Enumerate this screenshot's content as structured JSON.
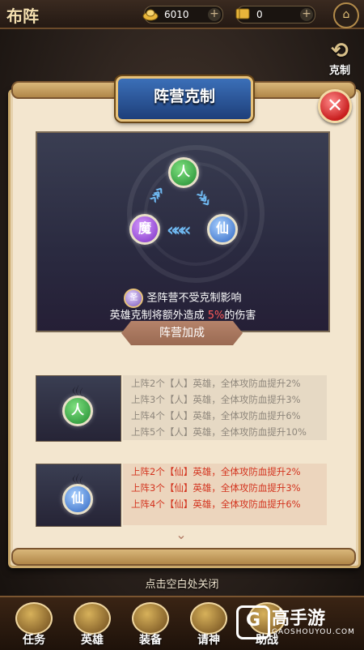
{
  "header": {
    "title": "布阵",
    "gold_value": "6010",
    "ticket_value": "0",
    "side_button_label": "克制"
  },
  "dialog": {
    "title": "阵营克制",
    "nodes": {
      "ren": "人",
      "mo": "魔",
      "xian": "仙"
    },
    "saint_text": "圣阵营不受克制影响",
    "bonus_prefix": "英雄克制将额外造成",
    "bonus_value": "5%",
    "bonus_suffix": "的伤害",
    "section_title": "阵营加成",
    "ren_bonuses": [
      "上阵2个【人】英雄，全体攻防血提升2%",
      "上阵3个【人】英雄，全体攻防血提升3%",
      "上阵4个【人】英雄，全体攻防血提升6%",
      "上阵5个【人】英雄，全体攻防血提升10%"
    ],
    "xian_bonuses": [
      "上阵2个【仙】英雄，全体攻防血提升2%",
      "上阵3个【仙】英雄，全体攻防血提升3%",
      "上阵4个【仙】英雄，全体攻防血提升6%"
    ]
  },
  "tip": "点击空白处关闭",
  "bottom_tabs": [
    "任务",
    "英雄",
    "装备",
    "请神",
    "助战"
  ],
  "watermark": {
    "brand": "GAOSHOUYOU.COM",
    "name": "高手游",
    "letter": "G"
  },
  "colors": {
    "accent_red": "#d3341f",
    "ren_green": "#1f8a2f",
    "xian_blue": "#2f66c2",
    "mo_purple": "#7a2fc2"
  }
}
